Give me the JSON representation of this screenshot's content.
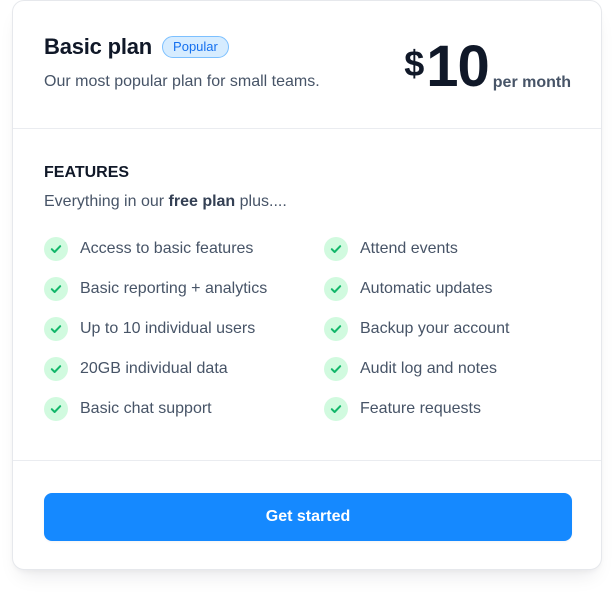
{
  "plan": {
    "title": "Basic plan",
    "badge": "Popular",
    "description": "Our most popular plan for small teams.",
    "price": {
      "currency": "$",
      "amount": "10",
      "period": "per month"
    }
  },
  "features": {
    "heading": "FEATURES",
    "subtitle_prefix": "Everything in our ",
    "subtitle_bold": "free plan",
    "subtitle_suffix": " plus....",
    "left": [
      {
        "label": "Access to basic features",
        "icon": "check-icon"
      },
      {
        "label": "Basic reporting + analytics",
        "icon": "check-icon"
      },
      {
        "label": "Up to 10 individual users",
        "icon": "check-icon"
      },
      {
        "label": "20GB individual data",
        "icon": "check-icon"
      },
      {
        "label": "Basic chat support",
        "icon": "check-icon"
      }
    ],
    "right": [
      {
        "label": "Attend events",
        "icon": "check-icon"
      },
      {
        "label": "Automatic updates",
        "icon": "check-icon"
      },
      {
        "label": "Backup your account",
        "icon": "check-icon"
      },
      {
        "label": "Audit log and notes",
        "icon": "check-icon"
      },
      {
        "label": "Feature requests",
        "icon": "check-icon"
      }
    ]
  },
  "cta": {
    "label": "Get started"
  },
  "colors": {
    "accent": "#1589ff",
    "check_bg": "#d1fadf",
    "check_fg": "#12b76a",
    "badge_bg": "#d6ecff",
    "badge_text": "#1570ef"
  }
}
